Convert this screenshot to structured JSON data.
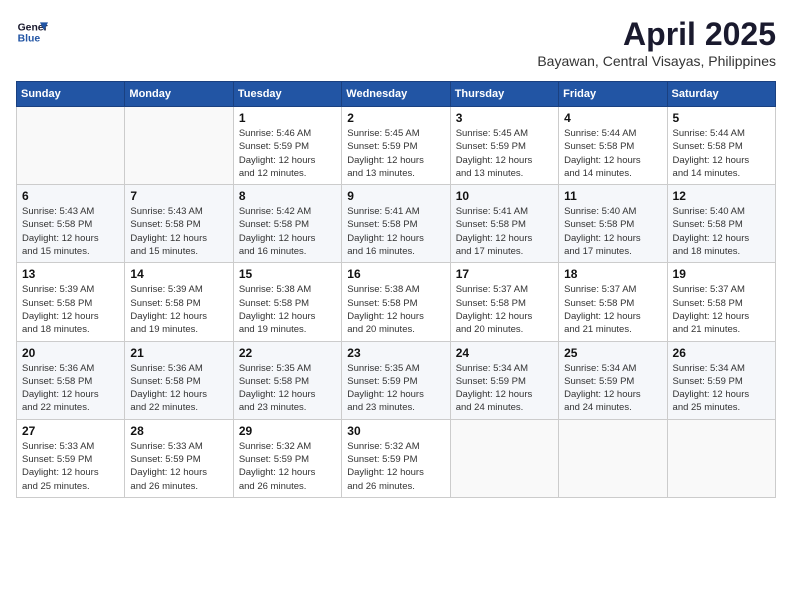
{
  "header": {
    "logo_line1": "General",
    "logo_line2": "Blue",
    "title": "April 2025",
    "location": "Bayawan, Central Visayas, Philippines"
  },
  "days_of_week": [
    "Sunday",
    "Monday",
    "Tuesday",
    "Wednesday",
    "Thursday",
    "Friday",
    "Saturday"
  ],
  "weeks": [
    [
      {
        "day": "",
        "info": ""
      },
      {
        "day": "",
        "info": ""
      },
      {
        "day": "1",
        "info": "Sunrise: 5:46 AM\nSunset: 5:59 PM\nDaylight: 12 hours\nand 12 minutes."
      },
      {
        "day": "2",
        "info": "Sunrise: 5:45 AM\nSunset: 5:59 PM\nDaylight: 12 hours\nand 13 minutes."
      },
      {
        "day": "3",
        "info": "Sunrise: 5:45 AM\nSunset: 5:59 PM\nDaylight: 12 hours\nand 13 minutes."
      },
      {
        "day": "4",
        "info": "Sunrise: 5:44 AM\nSunset: 5:58 PM\nDaylight: 12 hours\nand 14 minutes."
      },
      {
        "day": "5",
        "info": "Sunrise: 5:44 AM\nSunset: 5:58 PM\nDaylight: 12 hours\nand 14 minutes."
      }
    ],
    [
      {
        "day": "6",
        "info": "Sunrise: 5:43 AM\nSunset: 5:58 PM\nDaylight: 12 hours\nand 15 minutes."
      },
      {
        "day": "7",
        "info": "Sunrise: 5:43 AM\nSunset: 5:58 PM\nDaylight: 12 hours\nand 15 minutes."
      },
      {
        "day": "8",
        "info": "Sunrise: 5:42 AM\nSunset: 5:58 PM\nDaylight: 12 hours\nand 16 minutes."
      },
      {
        "day": "9",
        "info": "Sunrise: 5:41 AM\nSunset: 5:58 PM\nDaylight: 12 hours\nand 16 minutes."
      },
      {
        "day": "10",
        "info": "Sunrise: 5:41 AM\nSunset: 5:58 PM\nDaylight: 12 hours\nand 17 minutes."
      },
      {
        "day": "11",
        "info": "Sunrise: 5:40 AM\nSunset: 5:58 PM\nDaylight: 12 hours\nand 17 minutes."
      },
      {
        "day": "12",
        "info": "Sunrise: 5:40 AM\nSunset: 5:58 PM\nDaylight: 12 hours\nand 18 minutes."
      }
    ],
    [
      {
        "day": "13",
        "info": "Sunrise: 5:39 AM\nSunset: 5:58 PM\nDaylight: 12 hours\nand 18 minutes."
      },
      {
        "day": "14",
        "info": "Sunrise: 5:39 AM\nSunset: 5:58 PM\nDaylight: 12 hours\nand 19 minutes."
      },
      {
        "day": "15",
        "info": "Sunrise: 5:38 AM\nSunset: 5:58 PM\nDaylight: 12 hours\nand 19 minutes."
      },
      {
        "day": "16",
        "info": "Sunrise: 5:38 AM\nSunset: 5:58 PM\nDaylight: 12 hours\nand 20 minutes."
      },
      {
        "day": "17",
        "info": "Sunrise: 5:37 AM\nSunset: 5:58 PM\nDaylight: 12 hours\nand 20 minutes."
      },
      {
        "day": "18",
        "info": "Sunrise: 5:37 AM\nSunset: 5:58 PM\nDaylight: 12 hours\nand 21 minutes."
      },
      {
        "day": "19",
        "info": "Sunrise: 5:37 AM\nSunset: 5:58 PM\nDaylight: 12 hours\nand 21 minutes."
      }
    ],
    [
      {
        "day": "20",
        "info": "Sunrise: 5:36 AM\nSunset: 5:58 PM\nDaylight: 12 hours\nand 22 minutes."
      },
      {
        "day": "21",
        "info": "Sunrise: 5:36 AM\nSunset: 5:58 PM\nDaylight: 12 hours\nand 22 minutes."
      },
      {
        "day": "22",
        "info": "Sunrise: 5:35 AM\nSunset: 5:58 PM\nDaylight: 12 hours\nand 23 minutes."
      },
      {
        "day": "23",
        "info": "Sunrise: 5:35 AM\nSunset: 5:59 PM\nDaylight: 12 hours\nand 23 minutes."
      },
      {
        "day": "24",
        "info": "Sunrise: 5:34 AM\nSunset: 5:59 PM\nDaylight: 12 hours\nand 24 minutes."
      },
      {
        "day": "25",
        "info": "Sunrise: 5:34 AM\nSunset: 5:59 PM\nDaylight: 12 hours\nand 24 minutes."
      },
      {
        "day": "26",
        "info": "Sunrise: 5:34 AM\nSunset: 5:59 PM\nDaylight: 12 hours\nand 25 minutes."
      }
    ],
    [
      {
        "day": "27",
        "info": "Sunrise: 5:33 AM\nSunset: 5:59 PM\nDaylight: 12 hours\nand 25 minutes."
      },
      {
        "day": "28",
        "info": "Sunrise: 5:33 AM\nSunset: 5:59 PM\nDaylight: 12 hours\nand 26 minutes."
      },
      {
        "day": "29",
        "info": "Sunrise: 5:32 AM\nSunset: 5:59 PM\nDaylight: 12 hours\nand 26 minutes."
      },
      {
        "day": "30",
        "info": "Sunrise: 5:32 AM\nSunset: 5:59 PM\nDaylight: 12 hours\nand 26 minutes."
      },
      {
        "day": "",
        "info": ""
      },
      {
        "day": "",
        "info": ""
      },
      {
        "day": "",
        "info": ""
      }
    ]
  ]
}
